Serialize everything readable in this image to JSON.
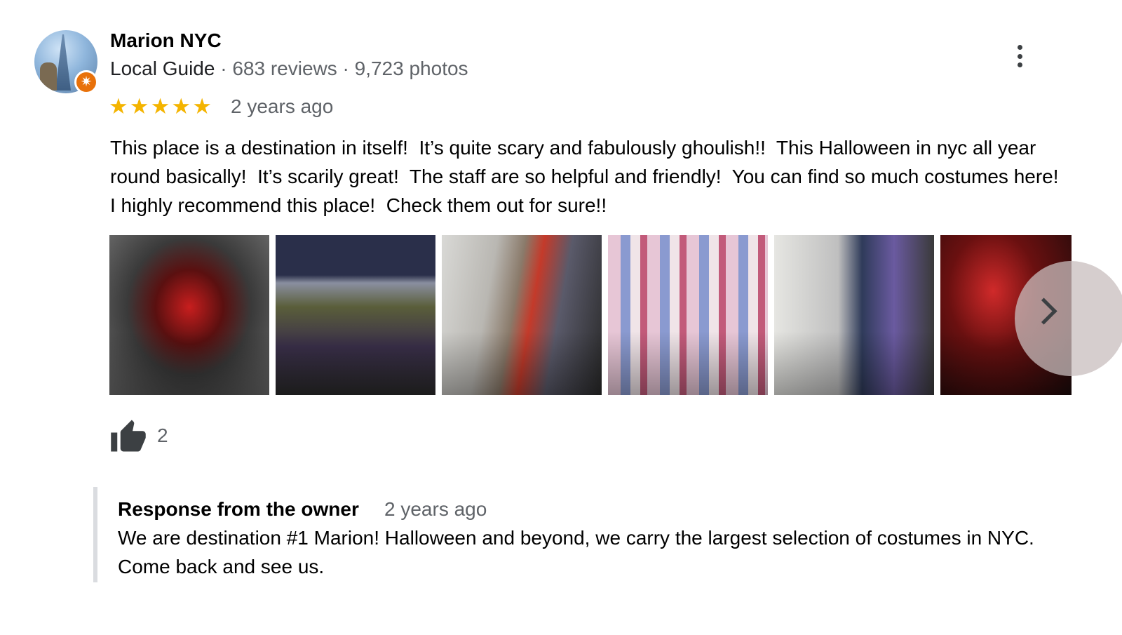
{
  "reviewer": {
    "name": "Marion NYC",
    "guide_label": "Local Guide",
    "separator": " · ",
    "reviews_count": "683 reviews",
    "photos_count": "9,723 photos",
    "badge_icon": "local-guide-star-icon"
  },
  "rating": {
    "stars": 5,
    "max": 5,
    "star_color": "#f4b400",
    "time_ago": "2 years ago"
  },
  "review_text": "This place is a destination in itself!  It’s quite scary and fabulously ghoulish!!  This Halloween in nyc all year round basically!  It’s scarily great!  The staff are so helpful and friendly!  You can find so much costumes here!  I highly recommend this place!  Check them out for sure!!",
  "photos": {
    "count_visible": 6,
    "next_icon": "chevron-right-icon"
  },
  "likes": {
    "icon": "thumbs-up-icon",
    "count": "2"
  },
  "owner_response": {
    "title": "Response from the owner",
    "time_ago": "2 years ago",
    "text": "We are destination #1 Marion! Halloween and beyond, we carry the largest selection of costumes in NYC. Come back and see us."
  },
  "menu": {
    "icon": "more-vertical-icon"
  }
}
